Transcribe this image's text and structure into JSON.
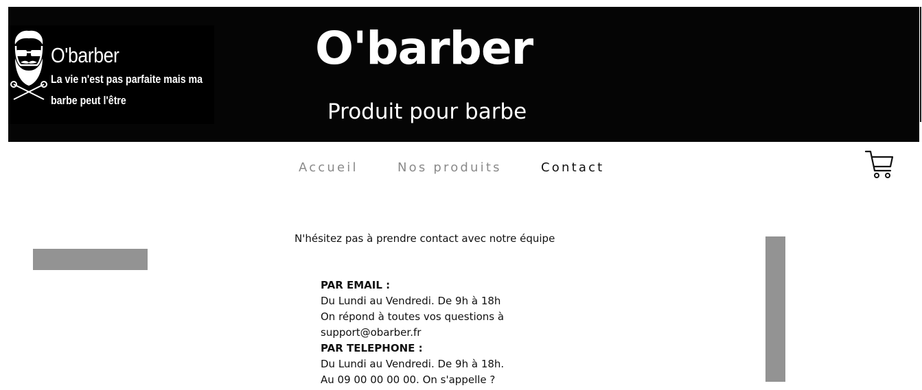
{
  "header": {
    "logo_title": "O'barber",
    "logo_tagline": "La vie n'est pas parfaite mais ma barbe peut l'être",
    "site_title": "O'barber",
    "site_subtitle": "Produit pour barbe",
    "background": "#050505"
  },
  "nav": {
    "items": [
      {
        "label": "Accueil",
        "state": "inactive"
      },
      {
        "label": "Nos produits",
        "state": "inactive"
      },
      {
        "label": "Contact",
        "state": "active"
      }
    ],
    "cart_icon": "shopping-cart-icon"
  },
  "main": {
    "intro": "N'hésitez pas à prendre contact avec notre équipe",
    "email_label": "PAR EMAIL :",
    "email_lines": [
      "Du Lundi au Vendredi. De 9h à 18h",
      "On répond à toutes vos questions à",
      "support@obarber.fr"
    ],
    "phone_label": "PAR TELEPHONE :",
    "phone_lines": [
      "Du Lundi au Vendredi. De 9h à 18h.",
      "Au 09 00 00 00 00. On s'appelle ?"
    ]
  },
  "colors": {
    "nav_inactive": "#8a8a8a",
    "nav_active": "#111111",
    "placeholder_gray": "#939393"
  }
}
